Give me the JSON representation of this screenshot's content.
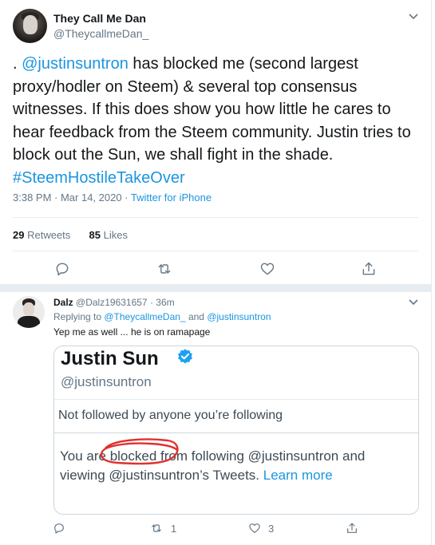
{
  "main_tweet": {
    "display_name": "They Call Me Dan",
    "handle": "@TheycallmeDan_",
    "text_prefix": ". ",
    "mention": "@justinsuntron",
    "text_body": " has blocked me (second largest proxy/hodler on Steem) & several top consensus witnesses. If this does show you how little he cares to hear feedback from the Steem community. Justin tries to block out the Sun, we shall fight in the shade.",
    "hashtag": "#SteemHostileTakeOver",
    "timestamp": "3:38 PM · Mar 14, 2020 · ",
    "source": "Twitter for iPhone",
    "retweets_count": "29",
    "retweets_label": "Retweets",
    "likes_count": "85",
    "likes_label": "Likes"
  },
  "reply": {
    "display_name": "Dalz",
    "handle_time": "@Dalz19631657 · 36m",
    "replying_prefix": "Replying to ",
    "replying_to_1": "@TheycallmeDan_",
    "replying_and": " and ",
    "replying_to_2": "@justinsuntron",
    "text": "Yep me as well ... he is on ramapage",
    "retweet_count": "1",
    "like_count": "3"
  },
  "embedded_image": {
    "profile_name": "Justin Sun",
    "profile_handle": "@justinsuntron",
    "follow_status": "Not followed by anyone you’re following",
    "blocked_message": "You are blocked from following @justinsuntron and viewing @justinsuntron’s Tweets. ",
    "learn_more": "Learn more"
  },
  "icons": [
    "chevron-down-icon",
    "reply-icon",
    "retweet-icon",
    "like-icon",
    "share-icon",
    "verified-badge-icon"
  ],
  "colors": {
    "link": "#1b95e0",
    "muted": "#657786",
    "border": "#e6ecf0",
    "scribble": "#e0312f"
  }
}
